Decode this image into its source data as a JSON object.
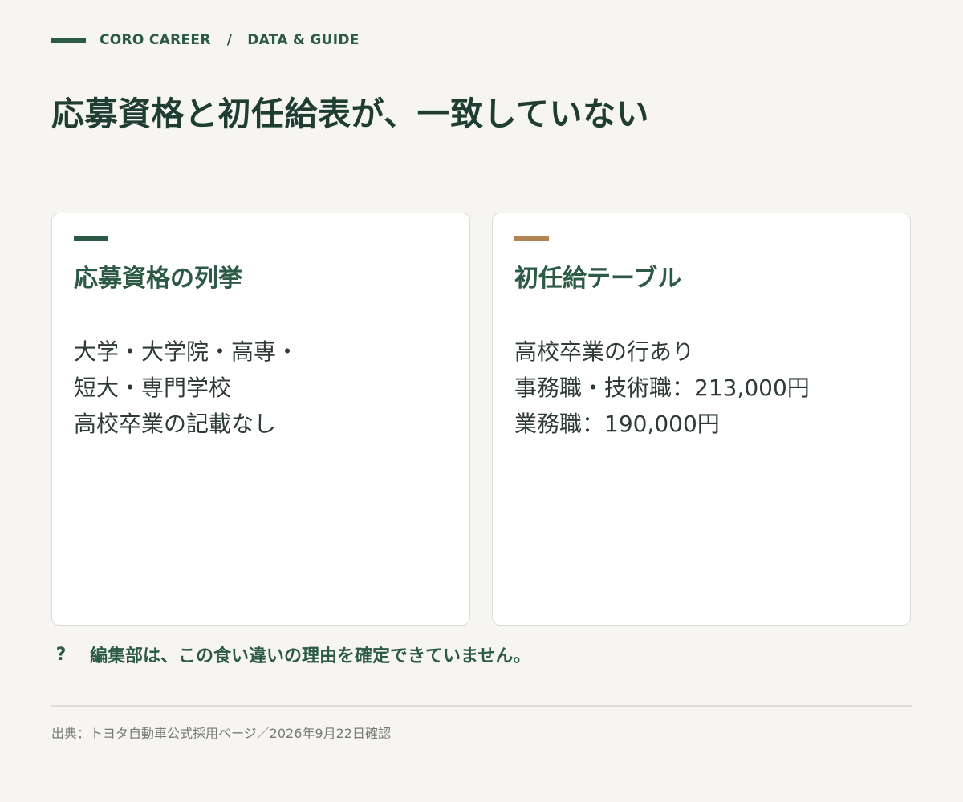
{
  "header": {
    "brand": "CORO CAREER",
    "separator": "/",
    "section": "DATA & GUIDE",
    "title": "応募資格と初任給表が、一致していない"
  },
  "cards": [
    {
      "title": "応募資格の列挙",
      "accent_color": "#2c5a47",
      "lines": [
        "大学・大学院・高専・",
        "短大・専門学校",
        "高校卒業の記載なし"
      ]
    },
    {
      "title": "初任給テーブル",
      "accent_color": "#b08552",
      "lines": [
        "高校卒業の行あり",
        "事務職・技術職：213,000円",
        "業務職：190,000円"
      ]
    }
  ],
  "note": {
    "icon": "question-icon",
    "icon_glyph": "?",
    "text": "編集部は、この食い違いの理由を確定できていません。"
  },
  "footer": {
    "source": "出典：トヨタ自動車公式採用ページ／2026年9月22日確認"
  },
  "colors": {
    "background": "#f6f5f1",
    "primary_green": "#2c5a47",
    "accent_gold": "#b08552",
    "card_background": "#ffffff"
  }
}
